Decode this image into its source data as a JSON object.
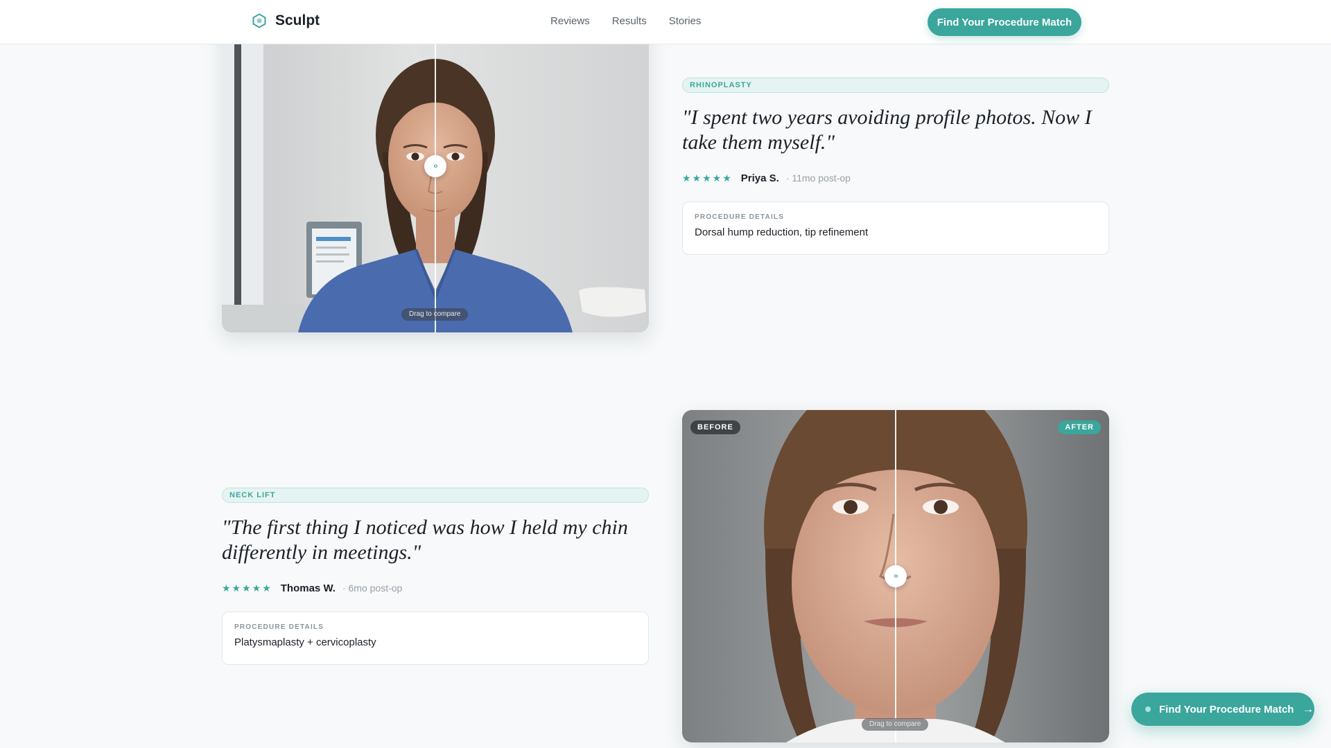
{
  "header": {
    "brand": "Sculpt",
    "nav": [
      "Reviews",
      "Results",
      "Stories"
    ],
    "cta_label": "Find Your Procedure Match"
  },
  "stories": [
    {
      "tag": "RHINOPLASTY",
      "quote": "\"I spent two years avoiding profile photos. Now I take them myself.\"",
      "rating": 5,
      "stars": "★★★★★",
      "author": "Priya S.",
      "postop": "· 11mo post-op",
      "details_label": "PROCEDURE DETAILS",
      "details_value": "Dorsal hump reduction, tip refinement",
      "compare_hint": "Drag to compare",
      "slider_position": 0.5
    },
    {
      "tag": "NECK LIFT",
      "quote": "\"The first thing I noticed was how I held my chin differently in meetings.\"",
      "rating": 5,
      "stars": "★★★★★",
      "author": "Thomas W.",
      "postop": "· 6mo post-op",
      "details_label": "PROCEDURE DETAILS",
      "details_value": "Platysmaplasty + cervicoplasty",
      "compare_hint": "Drag to compare",
      "before_label": "BEFORE",
      "after_label": "AFTER",
      "slider_position": 0.5
    }
  ],
  "floating_cta": {
    "label": "Find Your Procedure Match",
    "arrow": "→"
  },
  "handle_glyph": "‹›",
  "colors": {
    "accent": "#3aa69c",
    "background": "#f7f9fa",
    "text": "#1c2127"
  }
}
